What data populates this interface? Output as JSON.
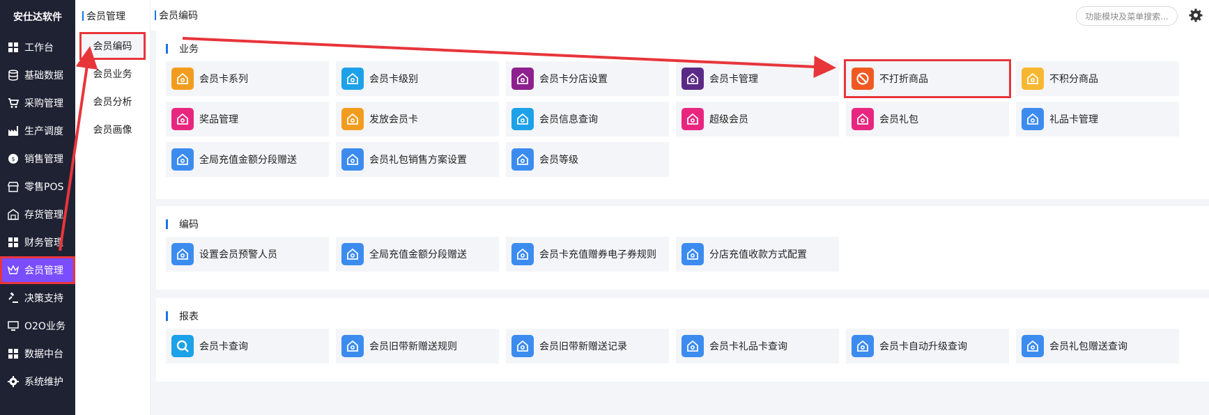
{
  "brand": "安仕达软件",
  "nav": [
    {
      "label": "工作台",
      "icon": "grid-icon"
    },
    {
      "label": "基础数据",
      "icon": "database-icon"
    },
    {
      "label": "采购管理",
      "icon": "cart-icon"
    },
    {
      "label": "生产调度",
      "icon": "factory-icon"
    },
    {
      "label": "销售管理",
      "icon": "sales-icon"
    },
    {
      "label": "零售POS",
      "icon": "store-icon"
    },
    {
      "label": "存货管理",
      "icon": "warehouse-icon"
    },
    {
      "label": "财务管理",
      "icon": "grid-icon"
    },
    {
      "label": "会员管理",
      "icon": "crown-icon"
    },
    {
      "label": "决策支持",
      "icon": "gavel-icon"
    },
    {
      "label": "O2O业务",
      "icon": "monitor-icon"
    },
    {
      "label": "数据中台",
      "icon": "grid-icon"
    },
    {
      "label": "系统维护",
      "icon": "gear-icon"
    }
  ],
  "submenu": {
    "title": "会员管理",
    "items": [
      "会员编码",
      "会员业务",
      "会员分析",
      "会员画像"
    ]
  },
  "page_title": "会员编码",
  "search_placeholder": "功能模块及菜单搜索...",
  "sections": [
    {
      "title": "业务",
      "cards": [
        {
          "label": "会员卡系列",
          "color": "#f29c1f"
        },
        {
          "label": "会员卡级别",
          "color": "#1da1e8"
        },
        {
          "label": "会员卡分店设置",
          "color": "#8e1f8f"
        },
        {
          "label": "会员卡管理",
          "color": "#5b2a86"
        },
        {
          "label": "不打折商品",
          "color": "#f05a22"
        },
        {
          "label": "不积分商品",
          "color": "#f7b731"
        },
        {
          "label": "奖品管理",
          "color": "#e8267f"
        },
        {
          "label": "发放会员卡",
          "color": "#f29c1f"
        },
        {
          "label": "会员信息查询",
          "color": "#1da1e8"
        },
        {
          "label": "超级会员",
          "color": "#e8267f"
        },
        {
          "label": "会员礼包",
          "color": "#e8267f"
        },
        {
          "label": "礼品卡管理",
          "color": "#3c8cf0"
        },
        {
          "label": "全局充值金额分段赠送",
          "color": "#3c8cf0"
        },
        {
          "label": "会员礼包销售方案设置",
          "color": "#3c8cf0"
        },
        {
          "label": "会员等级",
          "color": "#3c8cf0"
        }
      ]
    },
    {
      "title": "编码",
      "cards": [
        {
          "label": "设置会员预警人员",
          "color": "#3c8cf0"
        },
        {
          "label": "全局充值金额分段赠送",
          "color": "#3c8cf0"
        },
        {
          "label": "会员卡充值赠券电子券规则",
          "color": "#3c8cf0"
        },
        {
          "label": "分店充值收款方式配置",
          "color": "#3c8cf0"
        }
      ]
    },
    {
      "title": "报表",
      "cards": [
        {
          "label": "会员卡查询",
          "color": "#1da1e8"
        },
        {
          "label": "会员旧带新赠送规则",
          "color": "#3c8cf0"
        },
        {
          "label": "会员旧带新赠送记录",
          "color": "#3c8cf0"
        },
        {
          "label": "会员卡礼品卡查询",
          "color": "#3c8cf0"
        },
        {
          "label": "会员卡自动升级查询",
          "color": "#3c8cf0"
        },
        {
          "label": "会员礼包赠送查询",
          "color": "#3c8cf0"
        }
      ]
    }
  ],
  "colors": {
    "sidebar": "#1f2233",
    "active": "#7a4dff",
    "highlight": "#e8353a",
    "accent": "#1b73e8"
  }
}
